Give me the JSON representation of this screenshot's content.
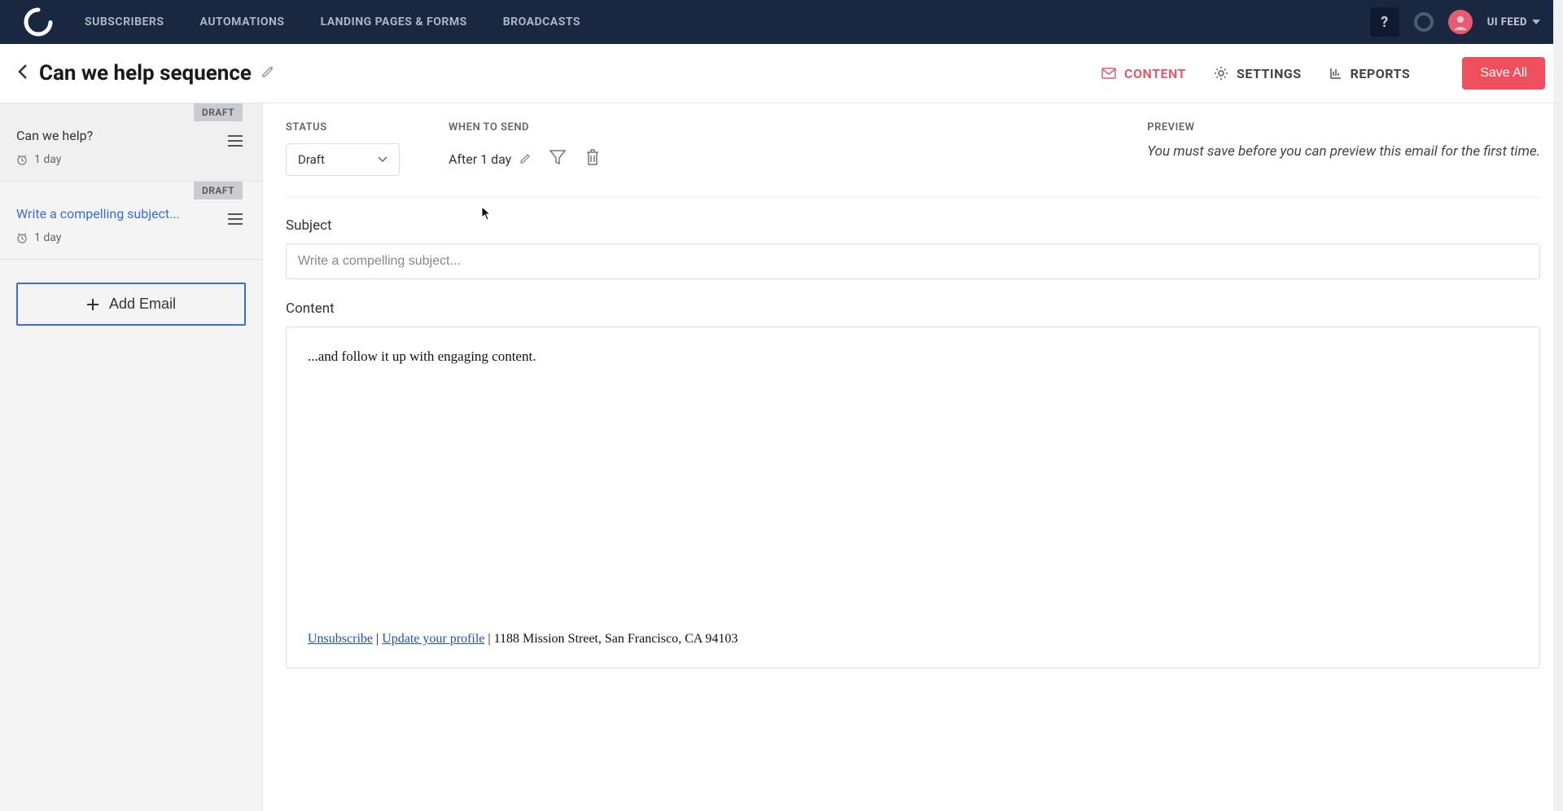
{
  "nav": {
    "items": [
      "SUBSCRIBERS",
      "AUTOMATIONS",
      "LANDING PAGES & FORMS",
      "BROADCASTS"
    ],
    "help": "?",
    "user_label": "UI FEED"
  },
  "header": {
    "title": "Can we help sequence",
    "tabs": {
      "content": "CONTENT",
      "settings": "SETTINGS",
      "reports": "REPORTS"
    },
    "save_all": "Save All"
  },
  "sidebar": {
    "emails": [
      {
        "badge": "DRAFT",
        "title": "Can we help?",
        "delay": "1 day",
        "placeholder": false
      },
      {
        "badge": "DRAFT",
        "title": "Write a compelling subject...",
        "delay": "1 day",
        "placeholder": true
      }
    ],
    "add_email_label": "Add Email"
  },
  "editor": {
    "status_label": "STATUS",
    "status_value": "Draft",
    "when_label": "WHEN TO SEND",
    "when_value": "After 1 day",
    "preview_label": "PREVIEW",
    "preview_text": "You must save before you can preview this email for the first time.",
    "subject_label": "Subject",
    "subject_placeholder": "Write a compelling subject...",
    "content_label": "Content",
    "content_body": "...and follow it up with engaging content.",
    "footer": {
      "unsubscribe": "Unsubscribe",
      "update": "Update your profile",
      "address": "1188 Mission Street, San Francisco, CA 94103"
    }
  }
}
